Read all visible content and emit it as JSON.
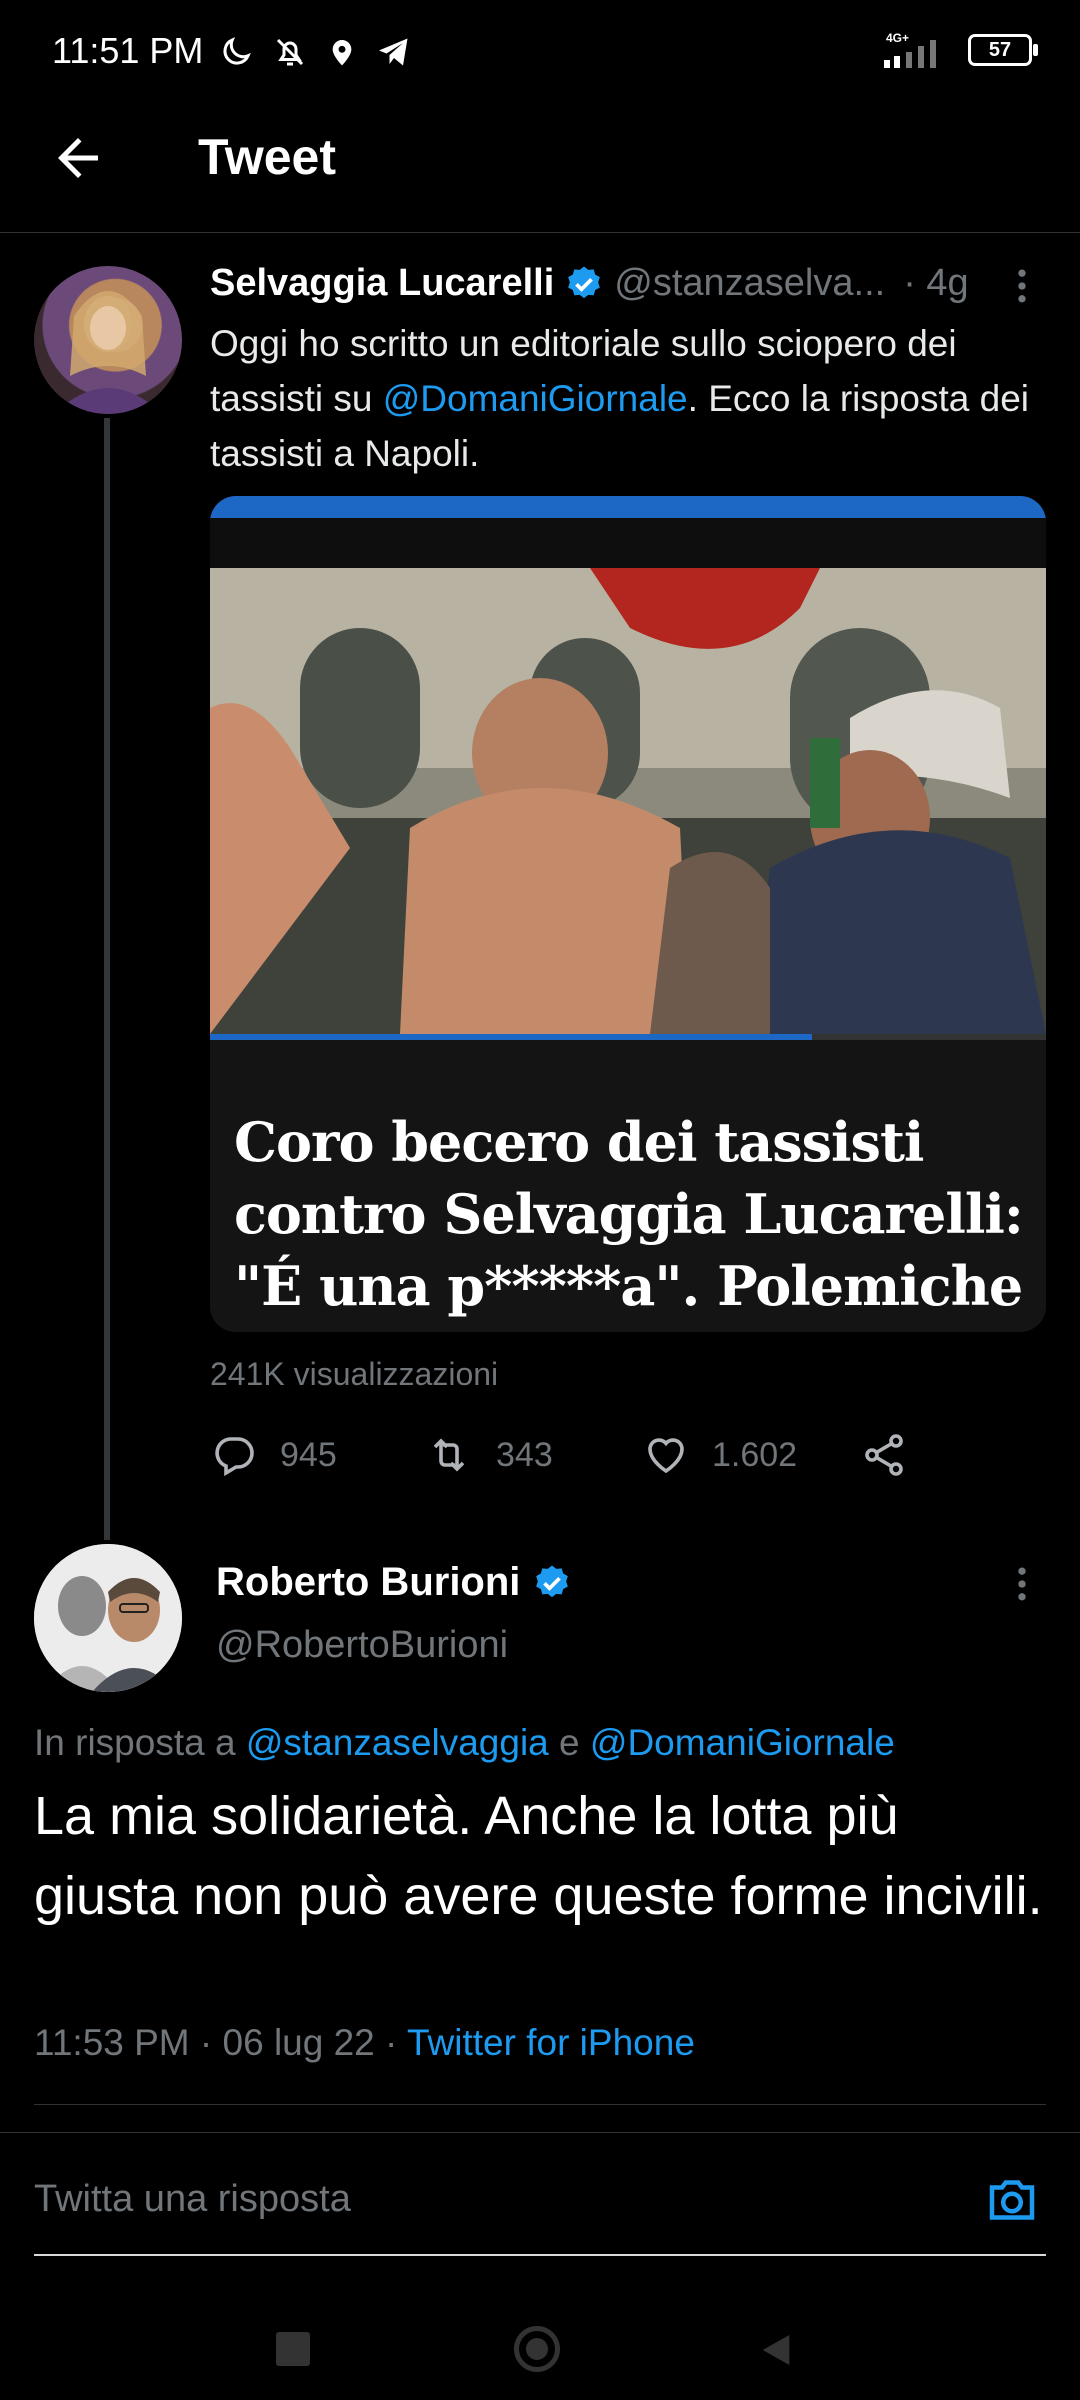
{
  "status_bar": {
    "time": "11:51 PM",
    "network": "4G+",
    "battery": "57"
  },
  "header": {
    "title": "Tweet"
  },
  "tweet": {
    "name": "Selvaggia Lucarelli",
    "handle": "@stanzaselva...",
    "time_ago": "· 4g",
    "text_part1": "Oggi ho scritto un editoriale sullo sciopero dei tassisti su ",
    "mention": "@DomaniGiornale",
    "text_part2": ". Ecco la risposta dei tassisti a Napoli.",
    "media_caption": "Coro becero dei tassisti contro Selvaggia Lucarelli: \"É una p*****a\". Polemiche",
    "views": "241K visualizzazioni",
    "replies": "945",
    "retweets": "343",
    "likes": "1.602"
  },
  "reply": {
    "name": "Roberto Burioni",
    "handle": "@RobertoBurioni",
    "in_reply_label": "In risposta a",
    "reply_to_1": "@stanzaselvaggia",
    "conjunction": "e",
    "reply_to_2": "@DomaniGiornale",
    "text": "La mia solidarietà. Anche la lotta più giusta non può avere queste forme incivili.",
    "time": "11:53 PM",
    "date": "06 lug 22",
    "source": "Twitter for iPhone"
  },
  "compose": {
    "placeholder": "Twitta una risposta"
  },
  "colors": {
    "accent": "#1d9bf0",
    "background": "#000000",
    "secondary_text": "#71767b"
  }
}
